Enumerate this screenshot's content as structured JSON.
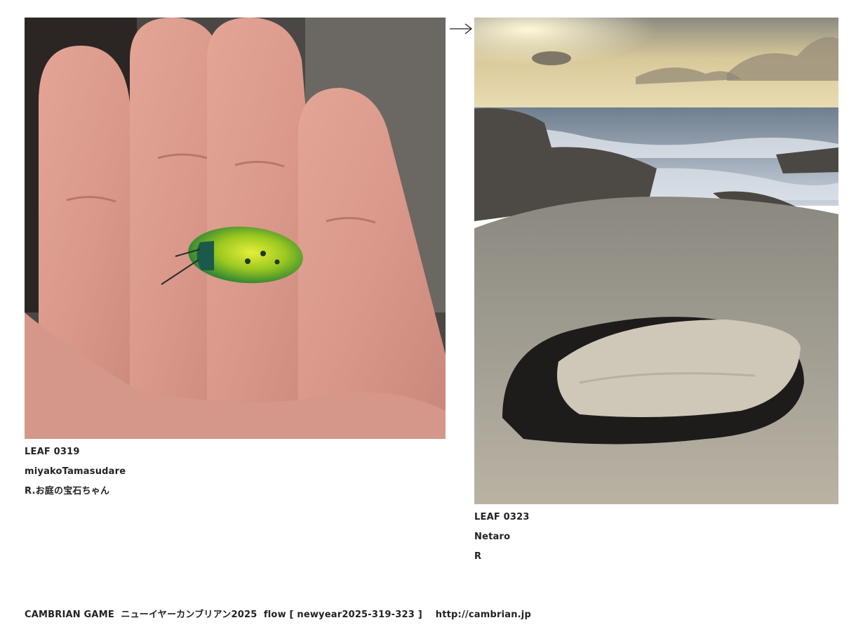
{
  "leaves": [
    {
      "leaf_id": "LEAF 0319",
      "author": "miyakoTamasudare",
      "comment": "R.お庭の宝石ちゃん"
    },
    {
      "leaf_id": "LEAF 0323",
      "author": "Netaro",
      "comment": "R"
    }
  ],
  "arrow_icon": "right-arrow-icon",
  "footer": {
    "game": "CAMBRIAN GAME",
    "event": "ニューイヤーカンブリアン2025",
    "flow": "flow [ newyear2025-319-323 ]",
    "url": "http://cambrian.jp"
  },
  "colors": {
    "text": "#222222",
    "background": "#ffffff"
  }
}
